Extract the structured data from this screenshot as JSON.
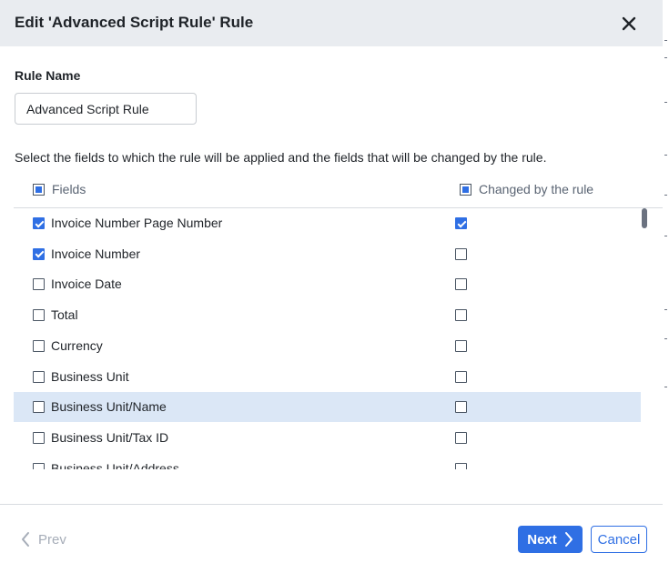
{
  "dialog": {
    "title": "Edit 'Advanced Script Rule' Rule",
    "close_icon": "close-icon"
  },
  "rule": {
    "label": "Rule Name",
    "value": "Advanced Script Rule"
  },
  "instructions": "Select the fields to which the rule will be applied and the fields that will be changed by the rule.",
  "columns": {
    "fields": "Fields",
    "changed": "Changed by the rule"
  },
  "rows": [
    {
      "name": "Invoice Number Page Number",
      "field_checked": true,
      "changed_checked": true,
      "highlighted": false
    },
    {
      "name": "Invoice Number",
      "field_checked": true,
      "changed_checked": false,
      "highlighted": false
    },
    {
      "name": "Invoice Date",
      "field_checked": false,
      "changed_checked": false,
      "highlighted": false
    },
    {
      "name": "Total",
      "field_checked": false,
      "changed_checked": false,
      "highlighted": false
    },
    {
      "name": "Currency",
      "field_checked": false,
      "changed_checked": false,
      "highlighted": false
    },
    {
      "name": "Business Unit",
      "field_checked": false,
      "changed_checked": false,
      "highlighted": false
    },
    {
      "name": "Business Unit/Name",
      "field_checked": false,
      "changed_checked": false,
      "highlighted": true
    },
    {
      "name": "Business Unit/Tax ID",
      "field_checked": false,
      "changed_checked": false,
      "highlighted": false
    },
    {
      "name": "Business Unit/Address",
      "field_checked": false,
      "changed_checked": false,
      "highlighted": false
    }
  ],
  "footer": {
    "prev": "Prev",
    "next": "Next",
    "cancel": "Cancel"
  },
  "colors": {
    "accent": "#2f6fe4",
    "header_bg": "#e9ecf0",
    "highlight": "#dbe7f6"
  }
}
